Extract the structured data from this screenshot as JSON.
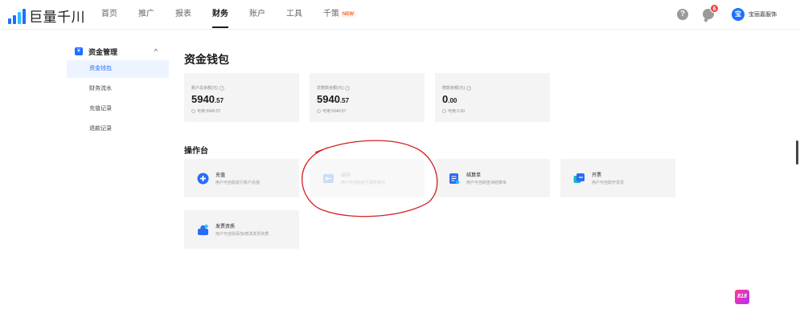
{
  "header": {
    "logo_text": "巨量千川",
    "nav": [
      {
        "label": "首页"
      },
      {
        "label": "推广"
      },
      {
        "label": "报表"
      },
      {
        "label": "财务"
      },
      {
        "label": "账户"
      },
      {
        "label": "工具"
      },
      {
        "label": "千策",
        "badge": "NEW"
      }
    ],
    "active_nav": "财务",
    "help_glyph": "?",
    "message_count": "6",
    "avatar_text": "宝",
    "username": "宝丽嘉服饰"
  },
  "sidebar": {
    "group_label": "资金管理",
    "group_icon": "¥",
    "caret": "^",
    "items": [
      {
        "label": "资金钱包"
      },
      {
        "label": "财务流水"
      },
      {
        "label": "充值记录"
      },
      {
        "label": "退款记录"
      }
    ],
    "active_item": "资金钱包"
  },
  "main": {
    "title": "资金钱包",
    "stats": [
      {
        "label": "账户总余额(元)",
        "value_int": "5940",
        "value_dec": ".57",
        "sub": "可用 5940.57"
      },
      {
        "label": "非赠款余额(元)",
        "value_int": "5940",
        "value_dec": ".57",
        "sub": "可用 5940.57"
      },
      {
        "label": "赠款余额(元)",
        "value_int": "0",
        "value_dec": ".00",
        "sub": "可用 0.00"
      }
    ],
    "ops_title": "操作台",
    "ops": [
      {
        "name": "充值",
        "desc": "用户可自助进行账户充值",
        "icon": "plus-circle-icon",
        "disabled": false
      },
      {
        "name": "退款",
        "desc": "用户可自助进行退款操作",
        "icon": "refund-icon",
        "disabled": true
      },
      {
        "name": "结算单",
        "desc": "用户可自助查询结算单",
        "icon": "statement-icon",
        "disabled": false
      },
      {
        "name": "开票",
        "desc": "用户可自助开发票",
        "icon": "invoice-icon",
        "disabled": false
      },
      {
        "name": "发票资质",
        "desc": "用户可自助添加/修改发票资质",
        "icon": "qualification-icon",
        "disabled": false
      }
    ]
  },
  "promo_text": "818",
  "colors": {
    "accent": "#1f6fff",
    "annotation": "#d42020",
    "badge": "#f04142",
    "new_badge": "#ff6a2a"
  }
}
